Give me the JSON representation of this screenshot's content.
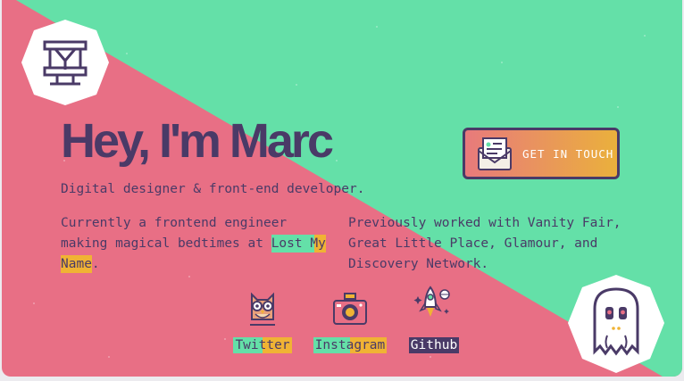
{
  "colors": {
    "pink": "#e86f85",
    "green": "#64e0a8",
    "ink": "#4a3a67",
    "yellow": "#f0b334",
    "white": "#ffffff"
  },
  "logo": {
    "icon": "mi-monogram-icon"
  },
  "hero": {
    "title": "Hey, I'm Marc",
    "subtitle": "Digital designer & front-end developer."
  },
  "intro_left": {
    "text": "Currently a frontend engineer making magical bedtimes at ",
    "link": "Lost My Name",
    "suffix": "."
  },
  "intro_right": {
    "text": "Previously worked with Vanity Fair, Great Little Place, Glamour, and Discovery Network."
  },
  "cta": {
    "label": "GET IN TOUCH",
    "icon": "envelope-letter-icon"
  },
  "social": [
    {
      "label": "Twitter",
      "icon": "owl-icon"
    },
    {
      "label": "Instagram",
      "icon": "camera-icon"
    },
    {
      "label": "Github",
      "icon": "rocket-icon"
    }
  ],
  "mascot": {
    "icon": "ghost-icon"
  }
}
